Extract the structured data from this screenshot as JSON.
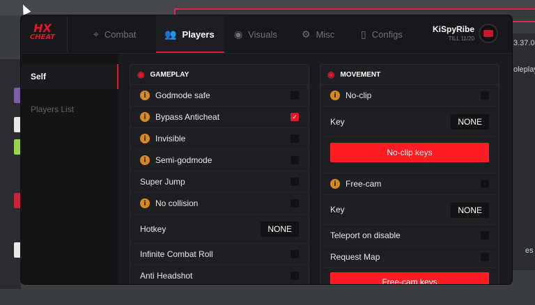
{
  "background": {
    "left_text": "",
    "right_texts": [
      "3.37.0",
      "oleplay",
      "es"
    ]
  },
  "brand": {
    "logo_line1": "HX",
    "logo_line2": "CHEAT",
    "accent": "#e3172a"
  },
  "tabs": [
    {
      "label": "Combat",
      "icon": "crosshair-icon",
      "glyph": "⌖"
    },
    {
      "label": "Players",
      "icon": "users-icon",
      "glyph": "👥"
    },
    {
      "label": "Visuals",
      "icon": "eye-icon",
      "glyph": "◉"
    },
    {
      "label": "Misc",
      "icon": "gear-icon",
      "glyph": "⚙"
    },
    {
      "label": "Configs",
      "icon": "file-icon",
      "glyph": "▯"
    }
  ],
  "user": {
    "name": "KiSpyRibe",
    "till": "TILL 11/20"
  },
  "sidebar": {
    "items": [
      {
        "label": "Self"
      },
      {
        "label": "Players List"
      }
    ]
  },
  "gameplay": {
    "title": "GAMEPLAY",
    "rows": [
      {
        "label": "Godmode safe",
        "info": true,
        "checked": false
      },
      {
        "label": "Bypass Anticheat",
        "info": true,
        "checked": true
      },
      {
        "label": "Invisible",
        "info": true,
        "checked": false
      },
      {
        "label": "Semi-godmode",
        "info": true,
        "checked": false
      },
      {
        "label": "Super Jump",
        "info": false,
        "checked": false
      },
      {
        "label": "No collision",
        "info": true,
        "checked": false
      }
    ],
    "hotkey": {
      "label": "Hotkey",
      "value": "NONE"
    },
    "rows2": [
      {
        "label": "Infinite Combat Roll"
      },
      {
        "label": "Anti Headshot"
      }
    ]
  },
  "movement": {
    "title": "MOVEMENT",
    "noclip": {
      "label": "No-clip"
    },
    "key1": {
      "label": "Key",
      "value": "NONE"
    },
    "noclip_keys": "No-clip keys",
    "freecam": {
      "label": "Free-cam"
    },
    "key2": {
      "label": "Key",
      "value": "NONE"
    },
    "teleport": {
      "label": "Teleport on disable"
    },
    "request_map": {
      "label": "Request Map"
    },
    "freecam_keys": "Free-cam keys"
  },
  "info_glyph": "i",
  "check_glyph": "✓"
}
